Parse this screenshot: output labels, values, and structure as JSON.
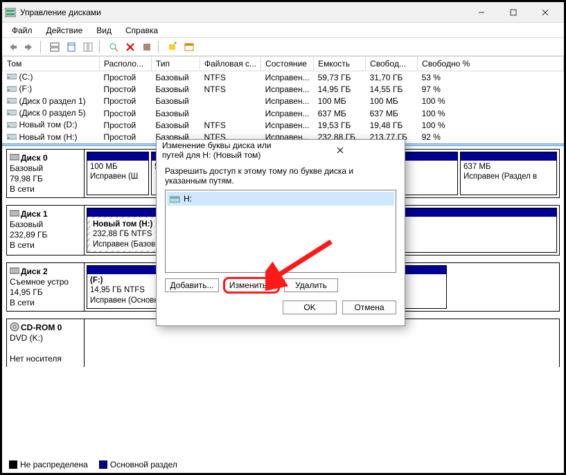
{
  "window": {
    "title": "Управление дисками"
  },
  "menu": {
    "file": "Файл",
    "action": "Действие",
    "view": "Вид",
    "help": "Справка"
  },
  "columns": {
    "volume": "Том",
    "layout": "Располо...",
    "type": "Тип",
    "fs": "Файловая с...",
    "status": "Состояние",
    "capacity": "Емкость",
    "free": "Свобод...",
    "freePct": "Свободно %"
  },
  "volumes": [
    {
      "name": "(C:)",
      "layout": "Простой",
      "type": "Базовый",
      "fs": "NTFS",
      "status": "Исправен...",
      "capacity": "59,73 ГБ",
      "free": "31,70 ГБ",
      "pct": "53 %"
    },
    {
      "name": "(F:)",
      "layout": "Простой",
      "type": "Базовый",
      "fs": "NTFS",
      "status": "Исправен...",
      "capacity": "14,95 ГБ",
      "free": "14,55 ГБ",
      "pct": "97 %"
    },
    {
      "name": "(Диск 0 раздел 1)",
      "layout": "Простой",
      "type": "Базовый",
      "fs": "",
      "status": "Исправен...",
      "capacity": "100 МБ",
      "free": "100 МБ",
      "pct": "100 %"
    },
    {
      "name": "(Диск 0 раздел 5)",
      "layout": "Простой",
      "type": "Базовый",
      "fs": "",
      "status": "Исправен...",
      "capacity": "637 МБ",
      "free": "637 МБ",
      "pct": "100 %"
    },
    {
      "name": "Новый том (D:)",
      "layout": "Простой",
      "type": "Базовый",
      "fs": "NTFS",
      "status": "Исправен...",
      "capacity": "19,53 ГБ",
      "free": "19,48 ГБ",
      "pct": "100 %"
    },
    {
      "name": "Новый том (H:)",
      "layout": "Простой",
      "type": "Базовый",
      "fs": "NTFS",
      "status": "Исправен...",
      "capacity": "232,88 ГБ",
      "free": "213,77 ГБ",
      "pct": "92 %"
    }
  ],
  "disks": {
    "d0": {
      "name": "Диск 0",
      "type": "Базовый",
      "size": "79,98 ГБ",
      "status": "В сети",
      "p1": {
        "size": "100 МБ",
        "status": "Исправен (Ш"
      },
      "p5": {
        "size": "637 МБ",
        "status": "Исправен (Раздел в"
      }
    },
    "d1": {
      "name": "Диск 1",
      "type": "Базовый",
      "size": "232,89 ГБ",
      "status": "В сети",
      "h": {
        "label": "Новый том  (H:)",
        "size": "232,88 ГБ NTFS",
        "status": "Исправен (Базов"
      }
    },
    "d2": {
      "name": "Диск 2",
      "type": "Съемное устро",
      "size": "14,95 ГБ",
      "status": "В сети",
      "f": {
        "label": "(F:)",
        "size": "14,95 ГБ NTFS",
        "status": "Исправен (Основной раздел)"
      }
    },
    "cd": {
      "name": "CD-ROM 0",
      "type": "DVD (K:)",
      "status": "Нет носителя"
    }
  },
  "legend": {
    "unalloc": "Не распределена",
    "primary": "Основной раздел"
  },
  "dialog": {
    "title": "Изменение буквы диска или путей для H: (Новый том)",
    "message": "Разрешить доступ к этому тому по букве диска и указанным путям.",
    "driveLetter": "H:",
    "add": "Добавить...",
    "change": "Изменить...",
    "delete": "Удалить",
    "ok": "OK",
    "cancel": "Отмена"
  }
}
